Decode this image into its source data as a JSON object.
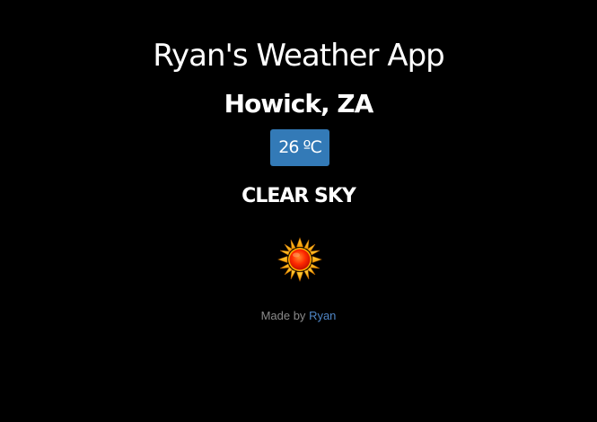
{
  "header": {
    "title": "Ryan's Weather App"
  },
  "weather": {
    "location": "Howick, ZA",
    "temperature": "26 ºC",
    "condition": "CLEAR SKY",
    "icon": "sun-icon"
  },
  "footer": {
    "prefix": "Made by",
    "author_link": "Ryan"
  },
  "colors": {
    "background": "#000000",
    "button": "#337ab7",
    "link": "#4f86c6",
    "footer_text": "#8a8a8a"
  }
}
